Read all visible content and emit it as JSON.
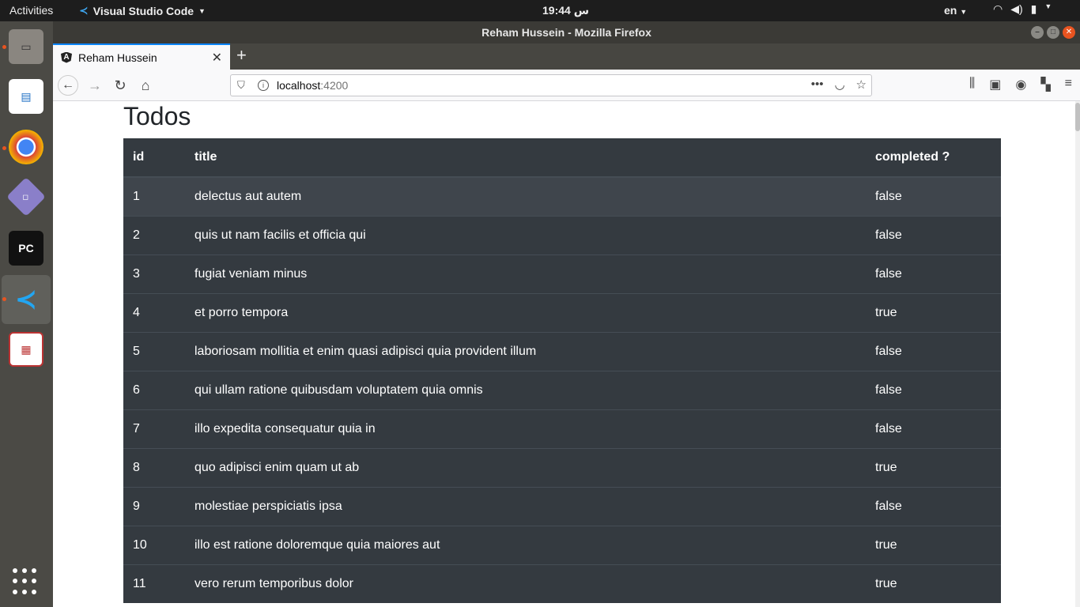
{
  "topbar": {
    "activities": "Activities",
    "app_name": "Visual Studio Code",
    "clock": "س 19:44",
    "language": "en"
  },
  "window": {
    "title": "Reham Hussein - Mozilla Firefox",
    "tab_title": "Reham Hussein",
    "url_host": "localhost",
    "url_port": ":4200"
  },
  "page": {
    "title": "Todos",
    "columns": {
      "id": "id",
      "title": "title",
      "completed": "completed ?"
    },
    "rows": [
      {
        "id": "1",
        "title": "delectus aut autem",
        "completed": "false"
      },
      {
        "id": "2",
        "title": "quis ut nam facilis et officia qui",
        "completed": "false"
      },
      {
        "id": "3",
        "title": "fugiat veniam minus",
        "completed": "false"
      },
      {
        "id": "4",
        "title": "et porro tempora",
        "completed": "true"
      },
      {
        "id": "5",
        "title": "laboriosam mollitia et enim quasi adipisci quia provident illum",
        "completed": "false"
      },
      {
        "id": "6",
        "title": "qui ullam ratione quibusdam voluptatem quia omnis",
        "completed": "false"
      },
      {
        "id": "7",
        "title": "illo expedita consequatur quia in",
        "completed": "false"
      },
      {
        "id": "8",
        "title": "quo adipisci enim quam ut ab",
        "completed": "true"
      },
      {
        "id": "9",
        "title": "molestiae perspiciatis ipsa",
        "completed": "false"
      },
      {
        "id": "10",
        "title": "illo est ratione doloremque quia maiores aut",
        "completed": "true"
      },
      {
        "id": "11",
        "title": "vero rerum temporibus dolor",
        "completed": "true"
      }
    ]
  },
  "colors": {
    "table_bg": "#343a40",
    "row_hover": "#3f454c",
    "tab_accent": "#0a84ff",
    "ubuntu_orange": "#e95420"
  }
}
